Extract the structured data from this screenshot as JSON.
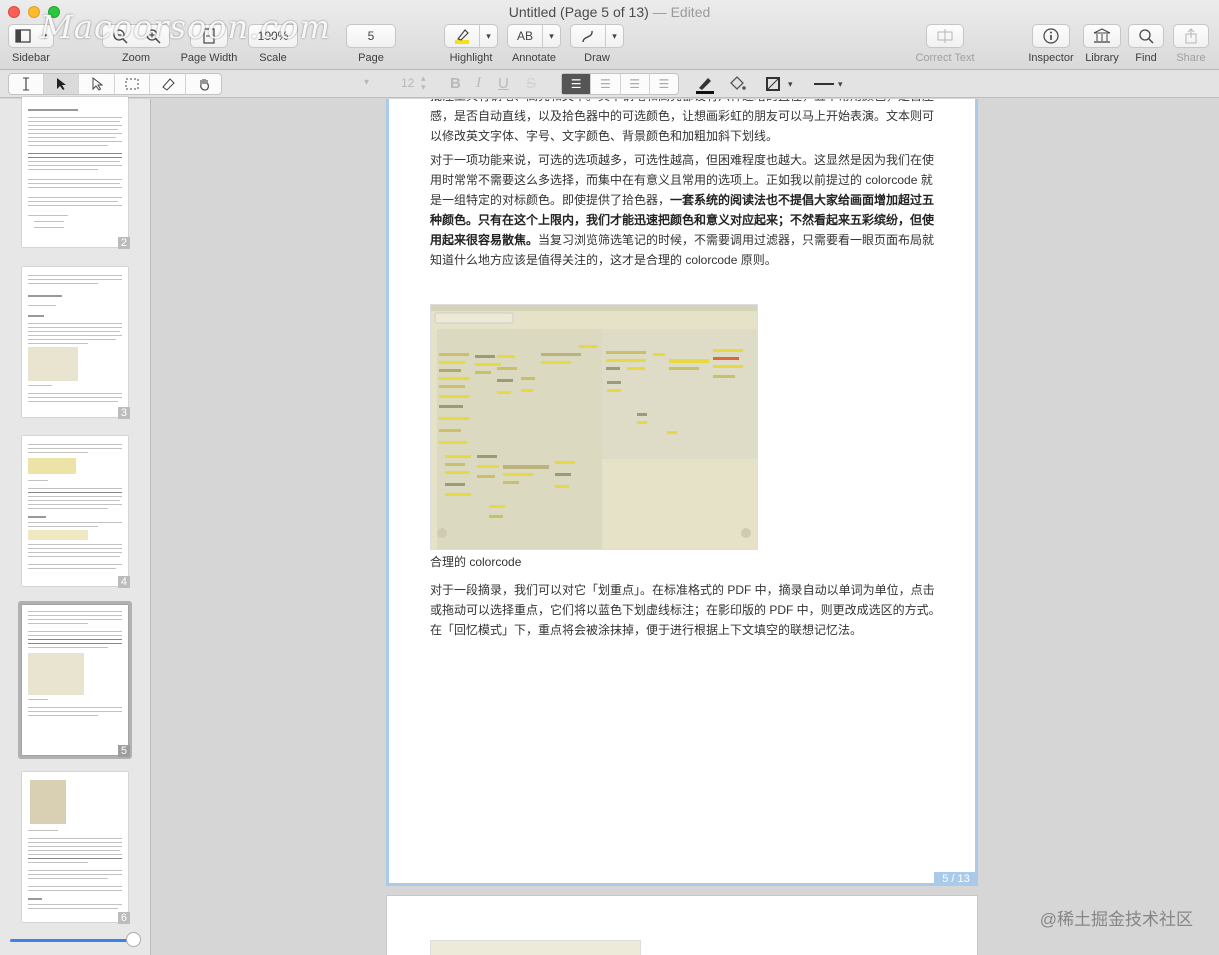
{
  "window": {
    "title": "Untitled (Page 5 of 13)",
    "edited": "— Edited",
    "watermark": "Macoorsoon.com"
  },
  "toolbar": {
    "sidebar_label": "Sidebar",
    "zoom_label": "Zoom",
    "page_width_label": "Page Width",
    "scale_label": "Scale",
    "scale_value": "100%",
    "page_label": "Page",
    "page_value": "5",
    "highlight_label": "Highlight",
    "annotate_label": "Annotate",
    "annotate_value": "AB",
    "draw_label": "Draw",
    "correct_text_label": "Correct Text",
    "inspector_label": "Inspector",
    "library_label": "Library",
    "find_label": "Find",
    "share_label": "Share"
  },
  "format_bar": {
    "font_size": "12",
    "bold": "B",
    "italic": "I",
    "underline": "U",
    "strike": "S"
  },
  "sidebar": {
    "thumbnails": [
      {
        "page": "2"
      },
      {
        "page": "3"
      },
      {
        "page": "4"
      },
      {
        "page": "5"
      },
      {
        "page": "6"
      }
    ],
    "selected_page": 5
  },
  "document": {
    "paragraph1": "批注工具有钢笔、高亮和文本。其中钢笔和高亮都设有六种递增的直径，五个常用颜色，是否压感，是否自动直线，以及拾色器中的可选颜色，让想画彩虹的朋友可以马上开始表演。文本则可以修改英文字体、字号、文字颜色、背景颜色和加粗加斜下划线。",
    "paragraph2_a": "对于一项功能来说，可选的选项越多，可选性越高，但困难程度也越大。这显然是因为我们在使用时常常不需要这么多选择，而集中在有意义且常用的选项上。正如我以前提过的 colorcode 就是一组特定的对标颜色。即使提供了拾色器，",
    "paragraph2_bold": "一套系统的阅读法也不提倡大家给画面增加超过五种颜色。只有在这个上限内，我们才能迅速把颜色和意义对应起来；不然看起来五彩缤纷，但使用起来很容易散焦。",
    "paragraph2_b": "当复习浏览筛选笔记的时候，不需要调用过滤器，只需要看一眼页面布局就知道什么地方应该是值得关注的，这才是合理的 colorcode 原则。",
    "caption": "合理的 colorcode",
    "paragraph3": "对于一段摘录，我们可以对它「划重点」。在标准格式的 PDF 中，摘录自动以单词为单位，点击或拖动可以选择重点，它们将以蓝色下划虚线标注；在影印版的 PDF 中，则更改成选区的方式。在「回忆模式」下，重点将会被涂抹掉，便于进行根据上下文填空的联想记忆法。",
    "page_badge": "5 / 13"
  },
  "footer_watermark": "@稀土掘金技术社区"
}
